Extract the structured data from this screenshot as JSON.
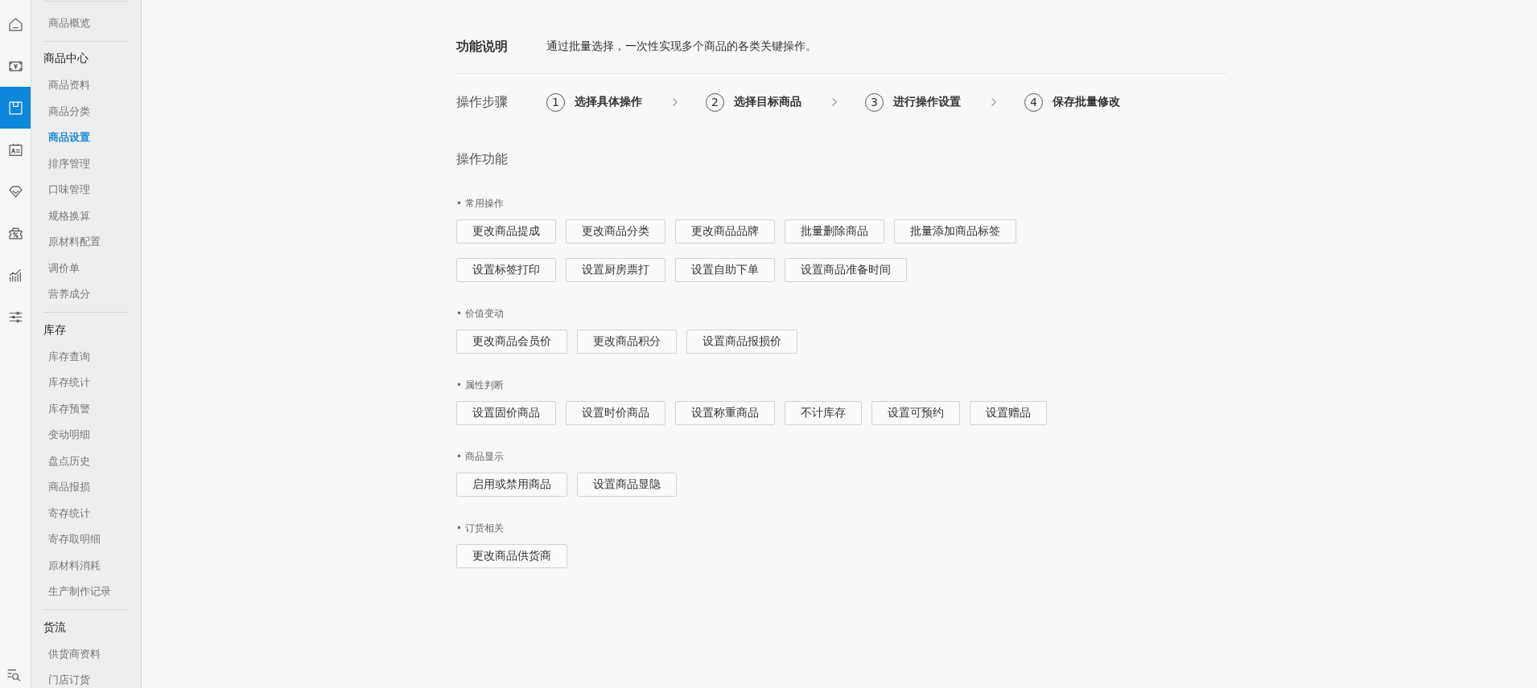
{
  "nav_rail": {
    "items": [
      {
        "selected": false
      },
      {
        "selected": false
      },
      {
        "selected": true
      },
      {
        "selected": false
      },
      {
        "selected": false
      },
      {
        "selected": false
      },
      {
        "selected": false
      },
      {
        "selected": false
      }
    ]
  },
  "sidebar": {
    "groups": [
      {
        "items": [
          {
            "label": "商品概览",
            "selected": false
          }
        ]
      },
      {
        "title": "商品中心",
        "items": [
          {
            "label": "商品资料",
            "selected": false
          },
          {
            "label": "商品分类",
            "selected": false
          },
          {
            "label": "商品设置",
            "selected": true
          },
          {
            "label": "排序管理",
            "selected": false
          },
          {
            "label": "口味管理",
            "selected": false
          },
          {
            "label": "规格换算",
            "selected": false
          },
          {
            "label": "原材料配置",
            "selected": false
          },
          {
            "label": "调价单",
            "selected": false
          },
          {
            "label": "营养成分",
            "selected": false
          }
        ]
      },
      {
        "title": "库存",
        "items": [
          {
            "label": "库存查询",
            "selected": false
          },
          {
            "label": "库存统计",
            "selected": false
          },
          {
            "label": "库存预警",
            "selected": false
          },
          {
            "label": "变动明细",
            "selected": false
          },
          {
            "label": "盘点历史",
            "selected": false
          },
          {
            "label": "商品报损",
            "selected": false
          },
          {
            "label": "寄存统计",
            "selected": false
          },
          {
            "label": "寄存取明细",
            "selected": false
          },
          {
            "label": "原材料消耗",
            "selected": false
          },
          {
            "label": "生产制作记录",
            "selected": false
          }
        ]
      },
      {
        "title": "货流",
        "items": [
          {
            "label": "供货商资料",
            "selected": false
          },
          {
            "label": "门店订货",
            "selected": false
          }
        ]
      }
    ]
  },
  "intro": {
    "title": "功能说明",
    "description": "通过批量选择，一次性实现多个商品的各类关键操作。"
  },
  "steps": {
    "title": "操作步骤",
    "items": [
      {
        "number": "1",
        "label": "选择具体操作"
      },
      {
        "number": "2",
        "label": "选择目标商品"
      },
      {
        "number": "3",
        "label": "进行操作设置"
      },
      {
        "number": "4",
        "label": "保存批量修改"
      }
    ]
  },
  "functions": {
    "title": "操作功能",
    "sections": [
      {
        "title": "• 常用操作",
        "rows": [
          [
            "更改商品提成",
            "更改商品分类",
            "更改商品品牌",
            "批量删除商品",
            "批量添加商品标签"
          ],
          [
            "设置标签打印",
            "设置厨房票打",
            "设置自助下单",
            "设置商品准备时间"
          ]
        ]
      },
      {
        "title": "• 价值变动",
        "rows": [
          [
            "更改商品会员价",
            "更改商品积分",
            "设置商品报损价"
          ]
        ]
      },
      {
        "title": "• 属性判断",
        "rows": [
          [
            "设置固价商品",
            "设置时价商品",
            "设置称重商品",
            "不计库存",
            "设置可预约",
            "设置赠品"
          ]
        ]
      },
      {
        "title": "• 商品显示",
        "rows": [
          [
            "启用或禁用商品",
            "设置商品显隐"
          ]
        ]
      },
      {
        "title": "• 订货相关",
        "rows": [
          [
            "更改商品供货商"
          ]
        ]
      }
    ]
  }
}
